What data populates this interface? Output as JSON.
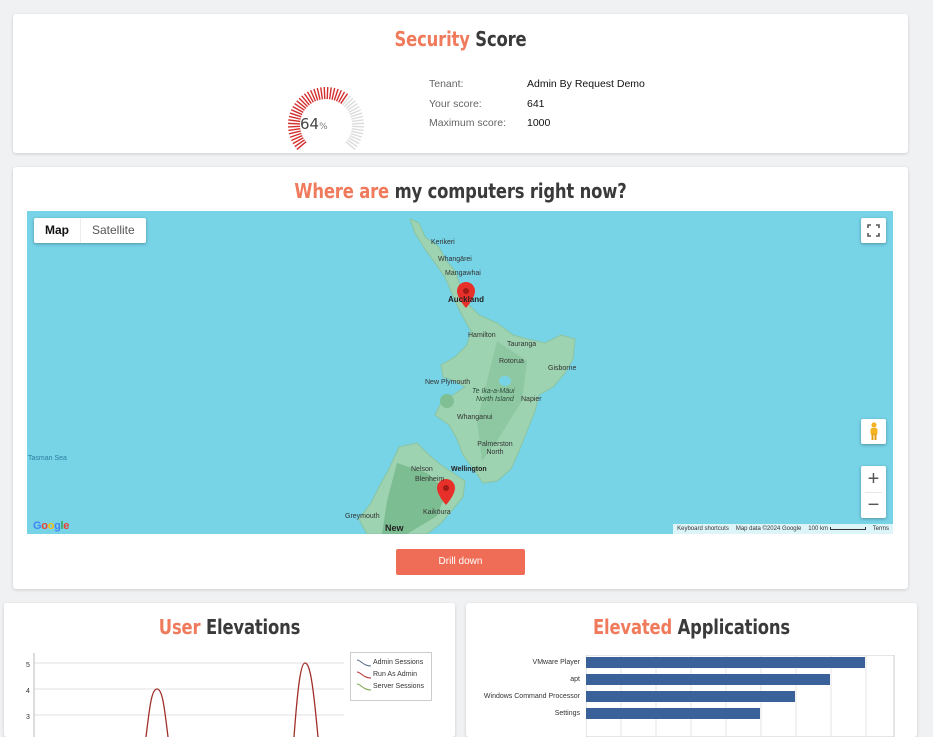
{
  "security": {
    "title_accent": "Security",
    "title_rest": "Score",
    "score_percent": 64,
    "score_percent_label": "64",
    "percent_sign": "%",
    "rows": [
      {
        "label": "Tenant:",
        "value": "Admin By Request Demo"
      },
      {
        "label": "Your score:",
        "value": "641"
      },
      {
        "label": "Maximum score:",
        "value": "1000"
      }
    ]
  },
  "map_section": {
    "title_accent": "Where are",
    "title_rest": "my computers right now?",
    "map_tab": "Map",
    "satellite_tab": "Satellite",
    "places": {
      "kerikeri": "Kerikeri",
      "whangarei": "Whangārei",
      "mangawhai": "Mangawhai",
      "auckland": "Auckland",
      "hamilton": "Hamilton",
      "tauranga": "Tauranga",
      "rotorua": "Rotorua",
      "gisborne": "Gisborne",
      "new_plymouth": "New Plymouth",
      "te_ika_a_maui": "Te Ika-a-Māui",
      "north_island": "North Island",
      "napier": "Napier",
      "whanganui": "Whanganui",
      "palmerston_north": "Palmerston North",
      "tasman_sea": "Tasman Sea",
      "nelson": "Nelson",
      "wellington": "Wellington",
      "blenheim": "Blenheim",
      "kaikoura": "Kaikōura",
      "greymouth": "Greymouth",
      "new": "New"
    },
    "attribution": {
      "shortcuts": "Keyboard shortcuts",
      "map_data": "Map data ©2024 Google",
      "scale": "100 km",
      "terms": "Terms"
    },
    "google_logo": "Google",
    "zoom_in": "+",
    "zoom_out": "−",
    "drill_button": "Drill down"
  },
  "user_elevations": {
    "title_accent": "User",
    "title_rest": "Elevations",
    "legend": [
      "Admin Sessions",
      "Run As Admin",
      "Server Sessions"
    ],
    "y_ticks": [
      "5",
      "4",
      "3"
    ]
  },
  "elevated_apps": {
    "title_accent": "Elevated",
    "title_rest": "Applications",
    "categories": [
      "VMware Player",
      "apt",
      "Windows Command Processor",
      "Settings"
    ]
  },
  "colors": {
    "accent": "#f07b5c",
    "gauge_red": "#d42e2e",
    "gauge_gray": "#dcdcdc",
    "bar_blue": "#3b619a",
    "button": "#ef6d56",
    "sea": "#77d3e6"
  },
  "icons": {
    "fullscreen": "fullscreen-icon",
    "pegman": "street-view-pegman-icon",
    "marker": "map-marker-icon"
  }
}
